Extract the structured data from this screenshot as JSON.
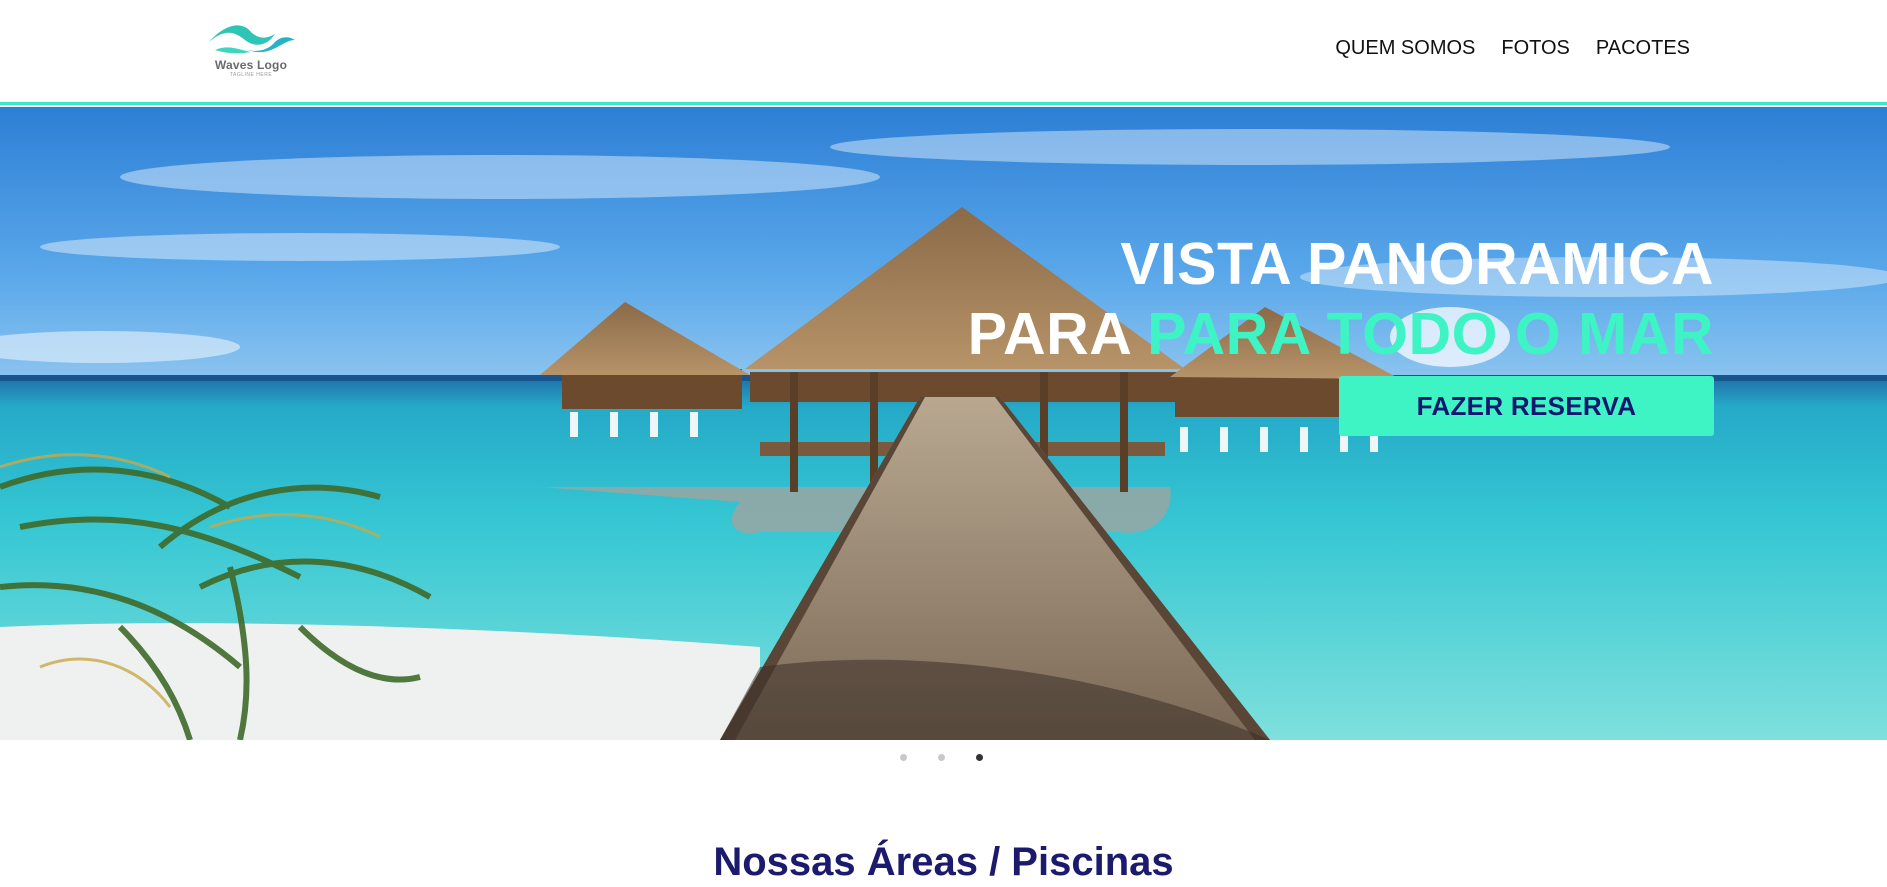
{
  "header": {
    "logo": {
      "name": "Waves Logo",
      "tagline": "TAGLINE HERE",
      "icon": "wave-icon",
      "color": "#2ec4b6"
    },
    "nav": [
      {
        "label": "QUEM SOMOS"
      },
      {
        "label": "FOTOS"
      },
      {
        "label": "PACOTES"
      }
    ],
    "border_color": "#3fe8c4"
  },
  "hero": {
    "title_line1": "VISTA PANORAMICA",
    "title_line2_white": "PARA",
    "title_line2_accent": "PARA TODO O MAR",
    "cta_label": "FAZER RESERVA",
    "accent_color": "#3ff4c4",
    "cta_text_color": "#141770"
  },
  "carousel": {
    "slides": 3,
    "active_slide": 3
  },
  "section": {
    "title": "Nossas Áreas / Piscinas",
    "title_color": "#1b1a6d"
  }
}
